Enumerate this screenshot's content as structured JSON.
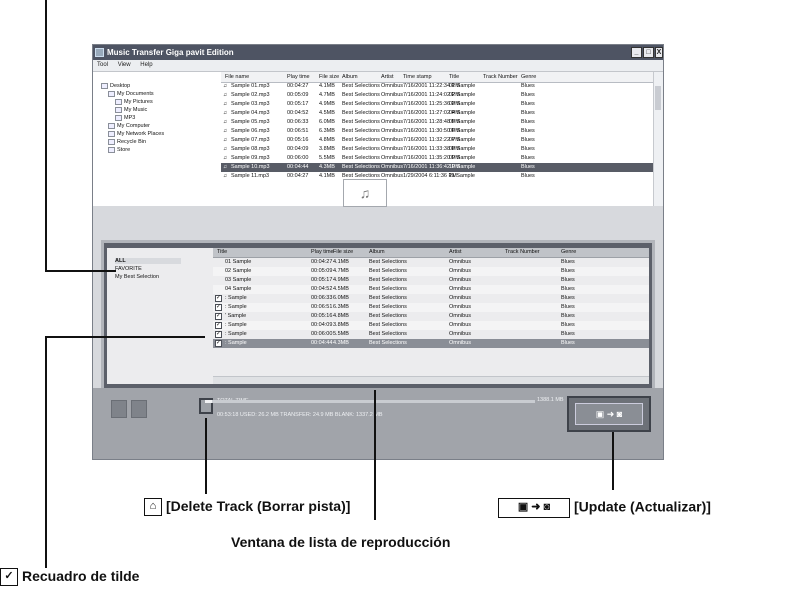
{
  "window": {
    "title": "Music Transfer Giga pavit Edition",
    "btn_min": "_",
    "btn_max": "□",
    "btn_close": "X"
  },
  "menu": [
    "Tool",
    "View",
    "Help"
  ],
  "tree": [
    {
      "label": "Desktop",
      "indent": 0
    },
    {
      "label": "My Documents",
      "indent": 1
    },
    {
      "label": "My Pictures",
      "indent": 2
    },
    {
      "label": "My Music",
      "indent": 2
    },
    {
      "label": "MP3",
      "indent": 2
    },
    {
      "label": "My Computer",
      "indent": 1
    },
    {
      "label": "My Network Places",
      "indent": 1
    },
    {
      "label": "Recycle Bin",
      "indent": 1
    },
    {
      "label": "Store",
      "indent": 1
    }
  ],
  "file_table": {
    "headers": [
      "File name",
      "Play time",
      "File size",
      "Album",
      "Artist",
      "Time stamp",
      "Title",
      "Track Number",
      "Genre"
    ],
    "rows": [
      [
        "Sample 01.mp3",
        "00:04:27",
        "4.1MB",
        "Best Selections",
        "Omnibus",
        "7/16/2001 11:22:34 PM",
        "01 Sample",
        "",
        "Blues"
      ],
      [
        "Sample 02.mp3",
        "00:05:09",
        "4.7MB",
        "Best Selections",
        "Omnibus",
        "7/16/2001 11:24:02 PM",
        "02 Sample",
        "",
        "Blues"
      ],
      [
        "Sample 03.mp3",
        "00:05:17",
        "4.9MB",
        "Best Selections",
        "Omnibus",
        "7/16/2001 11:25:36 PM",
        "03 Sample",
        "",
        "Blues"
      ],
      [
        "Sample 04.mp3",
        "00:04:52",
        "4.5MB",
        "Best Selections",
        "Omnibus",
        "7/16/2001 11:27:02 PM",
        "04 Sample",
        "",
        "Blues"
      ],
      [
        "Sample 05.mp3",
        "00:06:33",
        "6.0MB",
        "Best Selections",
        "Omnibus",
        "7/16/2001 11:28:48 PM",
        "05 Sample",
        "",
        "Blues"
      ],
      [
        "Sample 06.mp3",
        "00:06:51",
        "6.3MB",
        "Best Selections",
        "Omnibus",
        "7/16/2001 11:30:50 PM",
        "06 Sample",
        "",
        "Blues"
      ],
      [
        "Sample 07.mp3",
        "00:05:16",
        "4.8MB",
        "Best Selections",
        "Omnibus",
        "7/16/2001 11:32:22 PM",
        "07 Sample",
        "",
        "Blues"
      ],
      [
        "Sample 08.mp3",
        "00:04:09",
        "3.8MB",
        "Best Selections",
        "Omnibus",
        "7/16/2001 11:33:38 PM",
        "08 Sample",
        "",
        "Blues"
      ],
      [
        "Sample 09.mp3",
        "00:06:00",
        "5.5MB",
        "Best Selections",
        "Omnibus",
        "7/16/2001 11:35:20 PM",
        "09 Sample",
        "",
        "Blues"
      ],
      [
        "Sample 10.mp3",
        "00:04:44",
        "4.3MB",
        "Best Selections",
        "Omnibus",
        "7/16/2001 11:36:42 PM",
        "10 Sample",
        "",
        "Blues"
      ],
      [
        "Sample 11.mp3",
        "00:04:27",
        "4.1MB",
        "Best Selections",
        "Omnibus",
        "1/29/2004 6:11:36 PM",
        "11 Sample",
        "",
        "Blues"
      ]
    ],
    "selected_index": 9
  },
  "playlist_sidebar": [
    "ALL",
    "FAVORITE",
    "My Best Selection"
  ],
  "playlist_table": {
    "headers": [
      "Title",
      "Play time",
      "File size",
      "Album",
      "Artist",
      "Track Number",
      "Genre"
    ],
    "rows": [
      {
        "title": "01 Sample",
        "time": "00:04:27",
        "size": "4.1MB",
        "album": "Best Selections",
        "artist": "Omnibus",
        "track": "",
        "genre": "Blues",
        "check": false
      },
      {
        "title": "02 Sample",
        "time": "00:05:09",
        "size": "4.7MB",
        "album": "Best Selections",
        "artist": "Omnibus",
        "track": "",
        "genre": "Blues",
        "check": false
      },
      {
        "title": "03 Sample",
        "time": "00:05:17",
        "size": "4.9MB",
        "album": "Best Selections",
        "artist": "Omnibus",
        "track": "",
        "genre": "Blues",
        "check": false
      },
      {
        "title": "04 Sample",
        "time": "00:04:52",
        "size": "4.5MB",
        "album": "Best Selections",
        "artist": "Omnibus",
        "track": "",
        "genre": "Blues",
        "check": false
      },
      {
        "title": ": Sample",
        "time": "00:06:33",
        "size": "6.0MB",
        "album": "Best Selections",
        "artist": "Omnibus",
        "track": "",
        "genre": "Blues",
        "check": true
      },
      {
        "title": ": Sample",
        "time": "00:06:51",
        "size": "6.3MB",
        "album": "Best Selections",
        "artist": "Omnibus",
        "track": "",
        "genre": "Blues",
        "check": true
      },
      {
        "title": "' Sample",
        "time": "00:05:16",
        "size": "4.8MB",
        "album": "Best Selections",
        "artist": "Omnibus",
        "track": "",
        "genre": "Blues",
        "check": true
      },
      {
        "title": ": Sample",
        "time": "00:04:09",
        "size": "3.8MB",
        "album": "Best Selections",
        "artist": "Omnibus",
        "track": "",
        "genre": "Blues",
        "check": true
      },
      {
        "title": ": Sample",
        "time": "00:06:00",
        "size": "5.5MB",
        "album": "Best Selections",
        "artist": "Omnibus",
        "track": "",
        "genre": "Blues",
        "check": true
      },
      {
        "title": ": Sample",
        "time": "00:04:44",
        "size": "4.3MB",
        "album": "Best Selections",
        "artist": "Omnibus",
        "track": "",
        "genre": "Blues",
        "check": true
      }
    ],
    "selected_index": 9
  },
  "status": {
    "total_time_label": "TOTAL TIME",
    "line2": "00:53:18   USED: 26.2 MB   TRANSFER: 24.9 MB   BLANK: 1337.2 MB",
    "capacity": "1388.1 MB",
    "used_fraction": 0.02
  },
  "callouts": {
    "delete": "[Delete Track (Borrar pista)]",
    "update": "[Update (Actualizar)]",
    "playlist_window": "Ventana de lista de reproducción",
    "checkbox": "Recuadro de tilde"
  },
  "colors": {
    "titlebar": "#4e5463",
    "selected_row": "#585c66"
  }
}
